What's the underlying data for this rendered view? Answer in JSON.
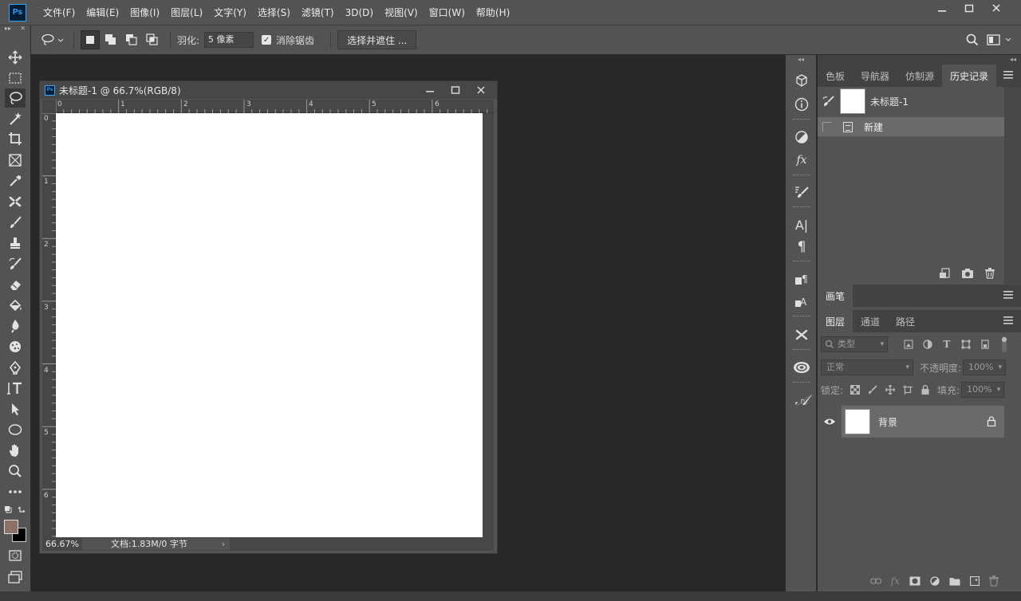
{
  "app": {
    "logo_text": "Ps",
    "menu": [
      "文件(F)",
      "编辑(E)",
      "图像(I)",
      "图层(L)",
      "文字(Y)",
      "选择(S)",
      "滤镜(T)",
      "3D(D)",
      "视图(V)",
      "窗口(W)",
      "帮助(H)"
    ]
  },
  "options": {
    "feather_label": "羽化:",
    "feather_value": "5 像素",
    "antialias_label": "消除锯齿",
    "antialias_checked": true,
    "select_mask_label": "选择并遮住 ..."
  },
  "document": {
    "title": "未标题-1 @ 66.7%(RGB/8)",
    "zoom": "66.67%",
    "info": "文档:1.83M/0 字节",
    "ruler_h": [
      "0",
      "1",
      "2",
      "3",
      "4",
      "5",
      "6"
    ],
    "ruler_v": [
      "0",
      "1",
      "2",
      "3",
      "4",
      "5",
      "6"
    ]
  },
  "panels": {
    "top_tabs": [
      "色板",
      "导航器",
      "仿制源",
      "历史记录"
    ],
    "top_active_tab": "历史记录",
    "history": {
      "snapshot_name": "未标题-1",
      "states": [
        "新建"
      ]
    },
    "brush_tab": "画笔",
    "layer_tabs": [
      "图层",
      "通道",
      "路径"
    ],
    "layer_active_tab": "图层",
    "layers_filter_placeholder": "类型",
    "blend_mode": "正常",
    "opacity_label": "不透明度:",
    "opacity_value": "100%",
    "lock_label": "锁定:",
    "fill_label": "填充:",
    "fill_value": "100%",
    "layers": [
      {
        "name": "背景",
        "visible": true,
        "locked": true
      }
    ]
  },
  "colors": {
    "foreground": "#8b7168",
    "background": "#000000",
    "accent": "#31a8ff"
  }
}
